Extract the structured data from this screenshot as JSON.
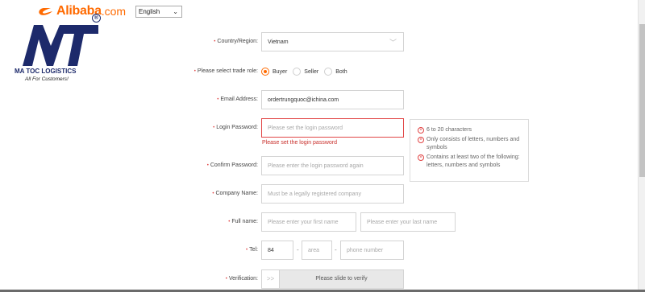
{
  "header": {
    "brand_name": "Alibaba",
    "brand_domain": ".com",
    "language": "English"
  },
  "watermark": {
    "title": "MA TOC LOGISTICS",
    "tagline": "All For Customers!",
    "registered": "®"
  },
  "form": {
    "country": {
      "label": "Country/Region:",
      "value": "Vietnam"
    },
    "trade_role": {
      "label": "Please select trade role:",
      "options": [
        "Buyer",
        "Seller",
        "Both"
      ],
      "selected": "Buyer"
    },
    "email": {
      "label": "Email Address:",
      "value": "ordertrungquoc@ichina.com"
    },
    "login_password": {
      "label": "Login Password:",
      "placeholder": "Please set the login password",
      "error": "Please set the login password"
    },
    "password_hints": [
      "6 to 20 characters",
      "Only consists of letters, numbers and symbols",
      "Contains at least two of the following: letters, numbers and symbols"
    ],
    "confirm_password": {
      "label": "Confirm Password:",
      "placeholder": "Please enter the login password again"
    },
    "company_name": {
      "label": "Company Name:",
      "placeholder": "Must be a legally registered company"
    },
    "full_name": {
      "label": "Full name:",
      "first_placeholder": "Please enter your first name",
      "last_placeholder": "Please enter your last name"
    },
    "tel": {
      "label": "Tel:",
      "country_code": "84",
      "area_placeholder": "area",
      "phone_placeholder": "phone number",
      "separator": "-"
    },
    "verification": {
      "label": "Verification:",
      "handle": ">>",
      "text": "Please slide to verify"
    }
  },
  "colors": {
    "accent": "#ff6a00",
    "error": "#e14545",
    "watermark": "#1d2a6b"
  }
}
